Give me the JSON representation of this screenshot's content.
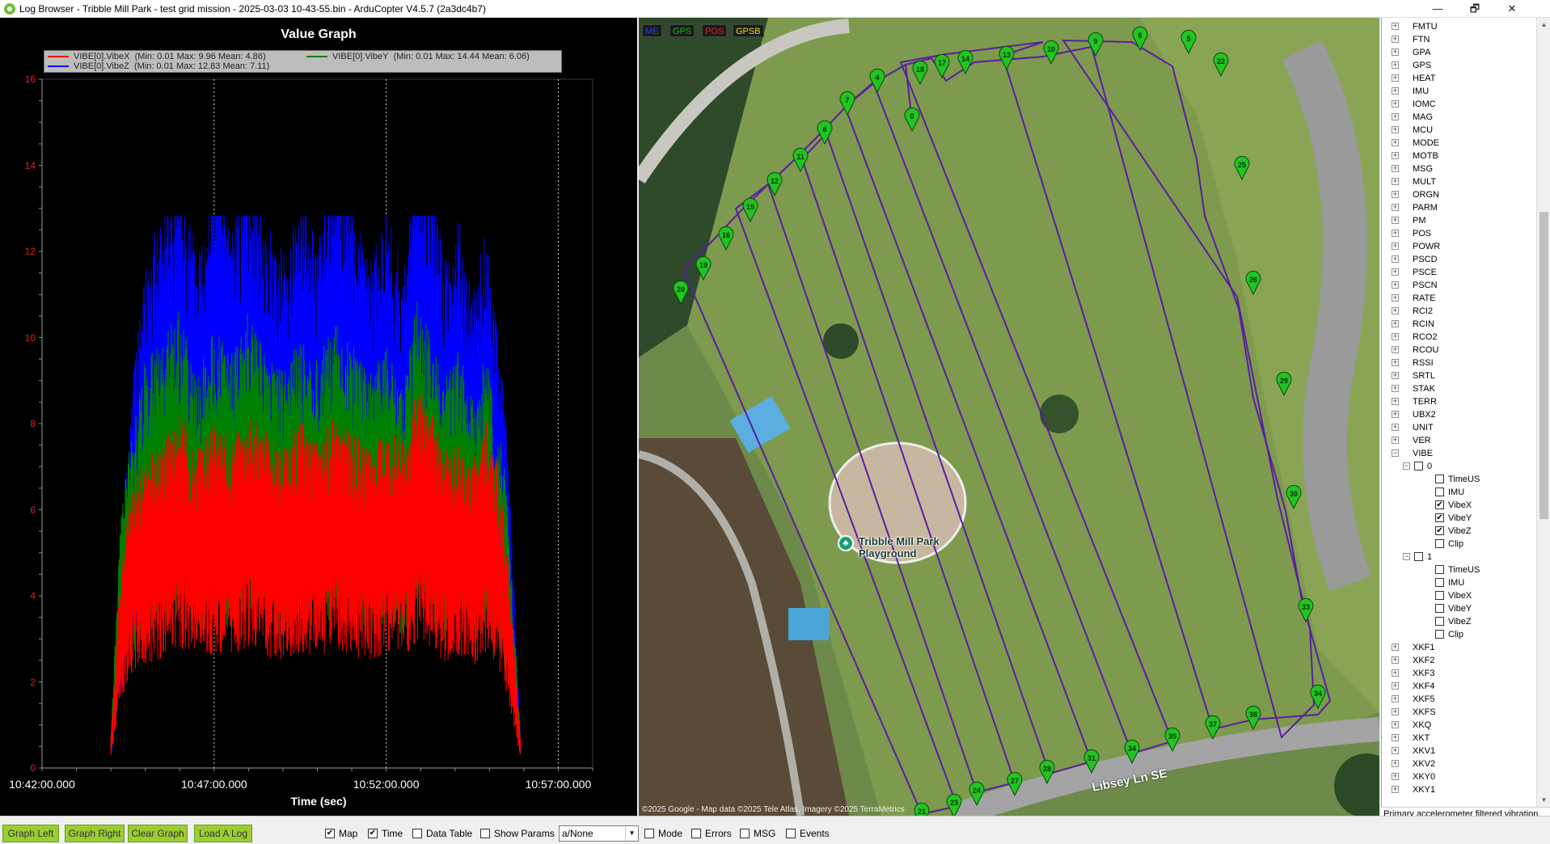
{
  "window": {
    "title": "Log Browser - Tribble Mill Park - test grid mission - 2025-03-03 10-43-55.bin - ArduCopter V4.5.7 (2a3dc4b7)",
    "minimize": "—",
    "maximize": "🗗",
    "close": "✕"
  },
  "graph": {
    "title": "Value Graph",
    "legend": [
      {
        "name": "VIBE[0].VibeX",
        "stats": "(Min: 0.01 Max: 9.96 Mean: 4.86)",
        "color": "#ff0000"
      },
      {
        "name": "VIBE[0].VibeY",
        "stats": "(Min: 0.01 Max: 14.44 Mean: 6.06)",
        "color": "#008000"
      },
      {
        "name": "VIBE[0].VibeZ",
        "stats": "(Min: 0.01 Max: 12.83 Mean: 7.11)",
        "color": "#0000ff"
      }
    ]
  },
  "chart_data": {
    "type": "line",
    "title": "Value Graph",
    "xlabel": "Time (sec)",
    "ylabel": "",
    "x_ticks": [
      "10:42:00.000",
      "10:47:00.000",
      "10:52:00.000",
      "10:57:00.000"
    ],
    "y_ticks": [
      "0",
      "2",
      "4",
      "6",
      "8",
      "10",
      "12",
      "14",
      "16"
    ],
    "ylim": [
      0,
      16
    ],
    "xlim_minutes": [
      0,
      16
    ],
    "series": [
      {
        "name": "VIBE[0].VibeX",
        "color": "#ff0000",
        "min": 0.01,
        "max": 9.96,
        "mean": 4.86,
        "x": [
          2.0,
          2.3,
          2.6,
          3.0,
          3.5,
          4.0,
          4.5,
          5.0,
          5.5,
          6.0,
          6.5,
          7.0,
          7.5,
          8.0,
          8.5,
          9.0,
          9.5,
          10.0,
          10.5,
          10.9,
          11.3,
          11.7,
          12.1,
          12.5,
          12.9,
          13.2,
          13.5,
          13.9
        ],
        "y": [
          0.5,
          3.2,
          4.5,
          4.8,
          5.2,
          5.6,
          5.0,
          5.4,
          5.2,
          5.6,
          5.3,
          5.0,
          5.5,
          5.1,
          5.6,
          5.3,
          5.0,
          5.4,
          5.2,
          6.0,
          5.6,
          5.0,
          5.2,
          4.8,
          5.5,
          4.9,
          3.6,
          0.5
        ]
      },
      {
        "name": "VIBE[0].VibeY",
        "color": "#008000",
        "min": 0.01,
        "max": 14.44,
        "mean": 6.06,
        "x": [
          2.0,
          2.3,
          2.6,
          3.0,
          3.5,
          4.0,
          4.5,
          5.0,
          5.5,
          6.0,
          6.5,
          7.0,
          7.5,
          8.0,
          8.5,
          9.0,
          9.5,
          10.0,
          10.5,
          10.9,
          11.3,
          11.7,
          12.1,
          12.5,
          12.9,
          13.2,
          13.5,
          13.9
        ],
        "y": [
          0.5,
          4.2,
          5.2,
          6.4,
          6.8,
          7.2,
          6.2,
          6.9,
          6.5,
          7.2,
          6.6,
          6.3,
          6.8,
          6.4,
          7.0,
          6.7,
          6.2,
          6.8,
          6.0,
          7.4,
          6.8,
          6.2,
          6.6,
          5.8,
          6.5,
          5.6,
          4.6,
          0.5
        ]
      },
      {
        "name": "VIBE[0].VibeZ",
        "color": "#0000ff",
        "min": 0.01,
        "max": 12.83,
        "mean": 7.11,
        "x": [
          2.0,
          2.3,
          2.6,
          3.0,
          3.5,
          4.0,
          4.5,
          5.0,
          5.5,
          6.0,
          6.5,
          7.0,
          7.5,
          8.0,
          8.5,
          9.0,
          9.5,
          10.0,
          10.5,
          10.9,
          11.3,
          11.7,
          12.1,
          12.5,
          12.9,
          13.2,
          13.5,
          13.9
        ],
        "y": [
          0.5,
          3.6,
          6.0,
          8.0,
          8.8,
          9.4,
          8.2,
          9.6,
          8.6,
          9.8,
          8.6,
          8.2,
          9.0,
          8.4,
          9.6,
          9.0,
          8.0,
          8.8,
          7.8,
          10.2,
          9.4,
          8.0,
          8.8,
          7.4,
          8.6,
          7.2,
          5.6,
          0.5
        ]
      }
    ]
  },
  "map": {
    "layers": [
      {
        "label": "ME",
        "color": "#1e3cff"
      },
      {
        "label": "GPS",
        "color": "#15c015"
      },
      {
        "label": "POS",
        "color": "#e02020"
      },
      {
        "label": "GPSB",
        "color": "#e6e600"
      }
    ],
    "poi_label": "Tribble Mill Park Playground",
    "road_label": "Libsey Ln SE",
    "attribution": "©2025 Google - Map data ©2025 Tele Atlas, Imagery ©2025 TerraMetrics",
    "path_color": "#5a1ea0",
    "marker_color": "#22c322",
    "waypoints": [
      "0",
      "4",
      "7",
      "8",
      "11",
      "12",
      "15",
      "16",
      "19",
      "20",
      "21",
      "23",
      "24",
      "27",
      "28",
      "31",
      "34",
      "35",
      "37",
      "38",
      "34",
      "33",
      "30",
      "29",
      "26",
      "25",
      "22",
      "5",
      "6",
      "9",
      "10",
      "13",
      "14",
      "17",
      "18"
    ]
  },
  "tree": {
    "items": [
      "FMTU",
      "FTN",
      "GPA",
      "GPS",
      "HEAT",
      "IMU",
      "IOMC",
      "MAG",
      "MCU",
      "MODE",
      "MOTB",
      "MSG",
      "MULT",
      "ORGN",
      "PARM",
      "PM",
      "POS",
      "POWR",
      "PSCD",
      "PSCE",
      "PSCN",
      "RATE",
      "RCI2",
      "RCIN",
      "RCO2",
      "RCOU",
      "RSSI",
      "SRTL",
      "STAK",
      "TERR",
      "UBX2",
      "UNIT",
      "VER",
      "VIBE"
    ],
    "vibe_instance_0": "0",
    "vibe_instance_1": "1",
    "fields0": [
      {
        "label": "TimeUS",
        "checked": false
      },
      {
        "label": "IMU",
        "checked": false
      },
      {
        "label": "VibeX",
        "checked": true
      },
      {
        "label": "VibeY",
        "checked": true
      },
      {
        "label": "VibeZ",
        "checked": true
      },
      {
        "label": "Clip",
        "checked": false
      }
    ],
    "fields1": [
      {
        "label": "TimeUS",
        "checked": false
      },
      {
        "label": "IMU",
        "checked": false
      },
      {
        "label": "VibeX",
        "checked": false
      },
      {
        "label": "VibeY",
        "checked": false
      },
      {
        "label": "VibeZ",
        "checked": false
      },
      {
        "label": "Clip",
        "checked": false
      }
    ],
    "items_after": [
      "XKF1",
      "XKF2",
      "XKF3",
      "XKF4",
      "XKF5",
      "XKFS",
      "XKQ",
      "XKT",
      "XKV1",
      "XKV2",
      "XKY0",
      "XKY1"
    ],
    "description": "Primary accelerometer filtered vibration, x-axis"
  },
  "bottom": {
    "buttons": [
      "Graph Left",
      "Graph Right",
      "Clear Graph",
      "Load A Log"
    ],
    "checks_left": [
      {
        "label": "Map",
        "checked": true
      },
      {
        "label": "Time",
        "checked": true
      },
      {
        "label": "Data Table",
        "checked": false
      },
      {
        "label": "Show Params",
        "checked": false
      }
    ],
    "dropdown_value": "a/None",
    "checks_right": [
      {
        "label": "Mode",
        "checked": false
      },
      {
        "label": "Errors",
        "checked": false
      },
      {
        "label": "MSG",
        "checked": false
      },
      {
        "label": "Events",
        "checked": false
      }
    ]
  }
}
